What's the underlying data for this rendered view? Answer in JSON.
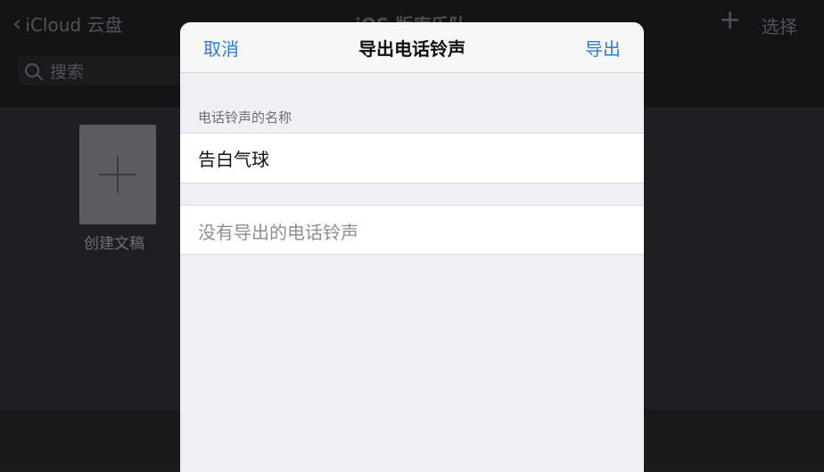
{
  "background": {
    "back_label": "iCloud 云盘",
    "title": "iOS 版库乐队",
    "select_label": "选择",
    "search_placeholder": "搜索",
    "create_label": "创建文稿"
  },
  "sheet": {
    "cancel_label": "取消",
    "title": "导出电话铃声",
    "export_label": "导出",
    "section_header": "电话铃声的名称",
    "ringtone_name": "告白气球",
    "empty_message": "没有导出的电话铃声"
  },
  "colors": {
    "accent": "#2f7ad6",
    "sheet_bg": "#efeff4",
    "dark_bg": "#1f1f23"
  }
}
